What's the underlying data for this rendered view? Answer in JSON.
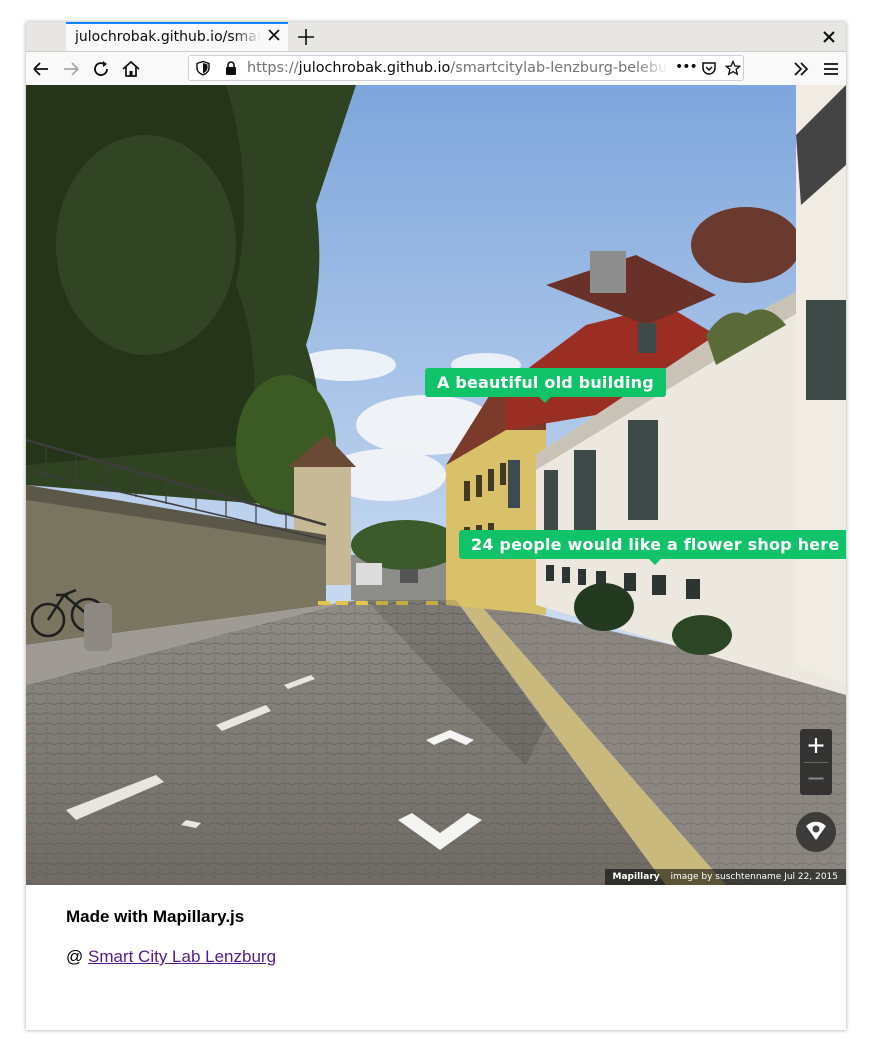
{
  "browser": {
    "tab_title": "julochrobak.github.io/smartcitylab-lenzburg-belebung",
    "url": {
      "scheme": "https://",
      "host": "julochrobak.github.io",
      "path": "/smartcitylab-lenzburg-belebung"
    },
    "overflow_icon": "•••"
  },
  "viewer": {
    "tags": [
      {
        "text": "A beautiful old building"
      },
      {
        "text": "24 people would like a flower shop here"
      }
    ],
    "zoom_in_icon": "plus-icon",
    "zoom_out_icon": "minus-icon",
    "attribution": {
      "brand": "Mapillary",
      "text": "image by suschtenname Jul 22, 2015"
    }
  },
  "page": {
    "made_with": "Made with Mapillary.js",
    "credit_prefix": "@",
    "credit_link": "Smart City Lab Lenzburg"
  },
  "colors": {
    "tag_green": "#10c268",
    "link": "#551a8b",
    "tab_accent": "#0a84ff"
  }
}
